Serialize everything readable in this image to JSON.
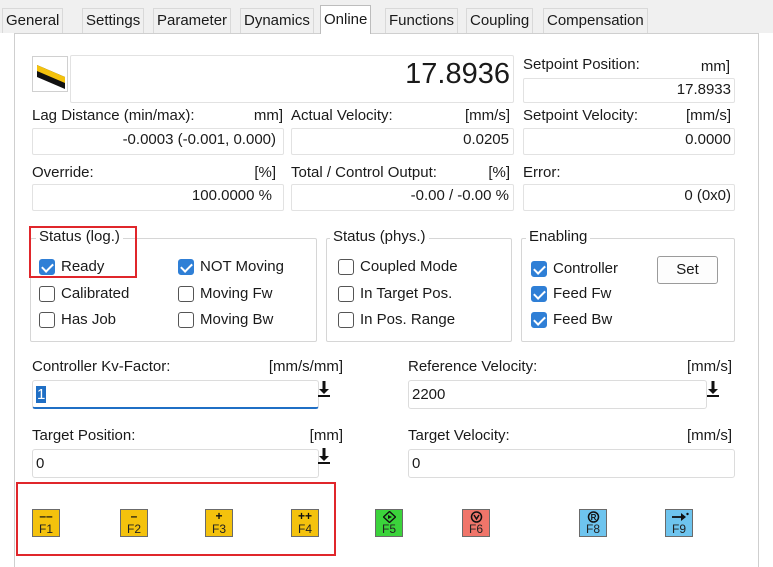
{
  "tabs": [
    "General",
    "Settings",
    "Parameter",
    "Dynamics",
    "Online",
    "Functions",
    "Coupling",
    "Compensation"
  ],
  "position": {
    "value": "17.8936"
  },
  "setpoint_position": {
    "label": "Setpoint Position:",
    "unit": "mm]",
    "value": "17.8933"
  },
  "lag_distance": {
    "label": "Lag Distance (min/max):",
    "unit": "mm]",
    "value": "-0.0003  (-0.001, 0.000)"
  },
  "actual_velocity": {
    "label": "Actual Velocity:",
    "unit": "[mm/s]",
    "value": "0.0205"
  },
  "setpoint_velocity": {
    "label": "Setpoint Velocity:",
    "unit": "[mm/s]",
    "value": "0.0000"
  },
  "override": {
    "label": "Override:",
    "unit": "[%]",
    "value": "100.0000 %"
  },
  "total_output": {
    "label": "Total / Control Output:",
    "unit": "[%]",
    "value": "-0.00 / -0.00 %"
  },
  "error": {
    "label": "Error:",
    "value": "0 (0x0)"
  },
  "status_log": {
    "title": "Status (log.)",
    "items": [
      {
        "label": "Ready",
        "checked": true
      },
      {
        "label": "NOT Moving",
        "checked": true
      },
      {
        "label": "Calibrated",
        "checked": false
      },
      {
        "label": "Moving Fw",
        "checked": false
      },
      {
        "label": "Has Job",
        "checked": false
      },
      {
        "label": "Moving Bw",
        "checked": false
      }
    ]
  },
  "status_phys": {
    "title": "Status (phys.)",
    "items": [
      {
        "label": "Coupled Mode",
        "checked": false
      },
      {
        "label": "In Target Pos.",
        "checked": false
      },
      {
        "label": "In Pos. Range",
        "checked": false
      }
    ]
  },
  "enabling": {
    "title": "Enabling",
    "items": [
      {
        "label": "Controller",
        "checked": true
      },
      {
        "label": "Feed Fw",
        "checked": true
      },
      {
        "label": "Feed Bw",
        "checked": true
      }
    ],
    "set_label": "Set"
  },
  "kv_factor": {
    "label": "Controller Kv-Factor:",
    "unit": "[mm/s/mm]",
    "value": "1"
  },
  "ref_velocity": {
    "label": "Reference Velocity:",
    "unit": "[mm/s]",
    "value": "2200"
  },
  "target_position": {
    "label": "Target Position:",
    "unit": "[mm]",
    "value": "0"
  },
  "target_velocity": {
    "label": "Target Velocity:",
    "unit": "[mm/s]",
    "value": "0"
  },
  "function_keys": [
    {
      "key": "F1",
      "symbol": "--",
      "color": "#f4c20d"
    },
    {
      "key": "F2",
      "symbol": "-",
      "color": "#f4c20d"
    },
    {
      "key": "F3",
      "symbol": "+",
      "color": "#f4c20d"
    },
    {
      "key": "F4",
      "symbol": "++",
      "color": "#f4c20d"
    },
    {
      "key": "F5",
      "symbol": "diamond-icon",
      "color": "#3bd33b"
    },
    {
      "key": "F6",
      "symbol": "stop-icon",
      "color": "#f0756a"
    },
    {
      "key": "F8",
      "symbol": "reset-icon",
      "color": "#6ec4ee"
    },
    {
      "key": "F9",
      "symbol": "arrow-right-icon",
      "color": "#6ec4ee"
    }
  ]
}
